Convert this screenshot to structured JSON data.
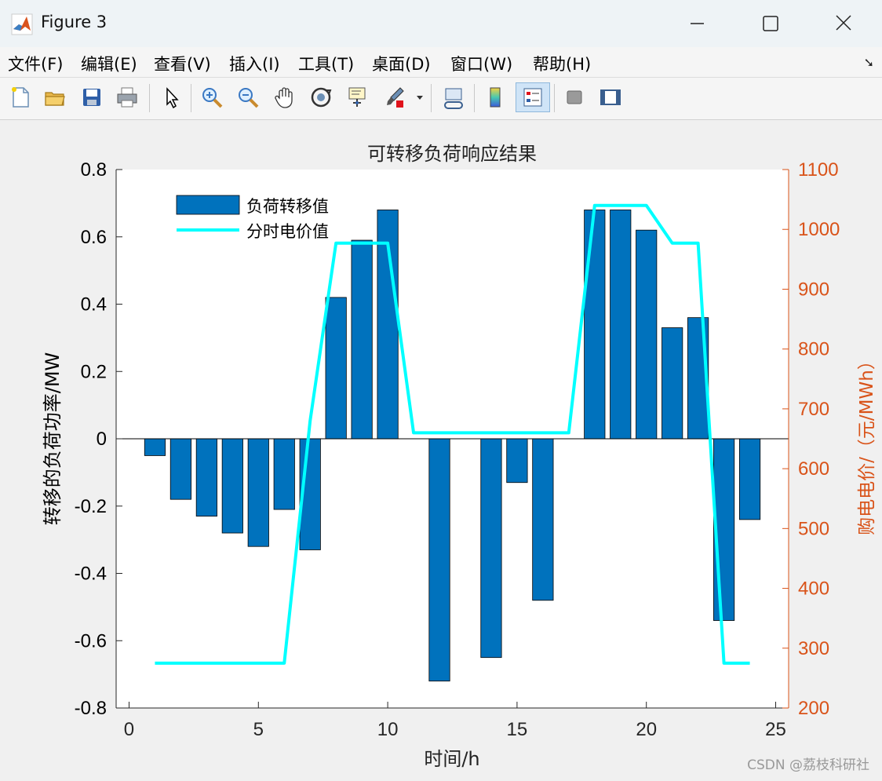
{
  "window": {
    "title": "Figure 3"
  },
  "menu": [
    {
      "label": "文件(F)"
    },
    {
      "label": "编辑(E)"
    },
    {
      "label": "查看(V)"
    },
    {
      "label": "插入(I)"
    },
    {
      "label": "工具(T)"
    },
    {
      "label": "桌面(D)"
    },
    {
      "label": "窗口(W)"
    },
    {
      "label": "帮助(H)"
    }
  ],
  "toolbar": [
    {
      "icon": "new-figure-icon"
    },
    {
      "icon": "open-file-icon"
    },
    {
      "icon": "save-icon"
    },
    {
      "icon": "print-icon"
    },
    {
      "icon": "select-arrow-icon"
    },
    {
      "icon": "zoom-in-icon"
    },
    {
      "icon": "zoom-out-icon"
    },
    {
      "icon": "pan-hand-icon"
    },
    {
      "icon": "rotate-3d-icon"
    },
    {
      "icon": "data-cursor-icon"
    },
    {
      "icon": "brush-icon"
    },
    {
      "icon": "link-plot-icon"
    },
    {
      "icon": "colorbar-icon"
    },
    {
      "icon": "legend-icon"
    },
    {
      "icon": "hide-plot-tools-icon"
    },
    {
      "icon": "show-plot-tools-icon"
    }
  ],
  "chart_data": {
    "type": "bar",
    "title": "可转移负荷响应结果",
    "xlabel": "时间/h",
    "ylabel_left": "转移的负荷功率/MW",
    "ylabel_right": "购电电价/（元/MWh）",
    "xlim": [
      -0.5,
      25.5
    ],
    "ylim_left": [
      -0.8,
      0.8
    ],
    "ylim_right": [
      200,
      1100
    ],
    "x_ticks": [
      "0",
      "5",
      "10",
      "15",
      "20",
      "25"
    ],
    "y_ticks_left": [
      "0.8",
      "0.6",
      "0.4",
      "0.2",
      "0",
      "-0.2",
      "-0.4",
      "-0.6",
      "-0.8"
    ],
    "y_ticks_right": [
      "1100",
      "1000",
      "900",
      "800",
      "700",
      "600",
      "500",
      "400",
      "300",
      "200"
    ],
    "x": [
      1,
      2,
      3,
      4,
      5,
      6,
      7,
      8,
      9,
      10,
      11,
      12,
      13,
      14,
      15,
      16,
      17,
      18,
      19,
      20,
      21,
      22,
      23,
      24
    ],
    "series": [
      {
        "name": "负荷转移值",
        "type": "bar",
        "axis": "left",
        "color": "#0072BD",
        "values": [
          -0.05,
          -0.18,
          -0.23,
          -0.28,
          -0.32,
          -0.21,
          -0.33,
          0.42,
          0.59,
          0.68,
          0,
          -0.72,
          0,
          -0.65,
          -0.13,
          -0.48,
          0,
          0.68,
          0.68,
          0.62,
          0.33,
          0.36,
          -0.54,
          -0.24
        ]
      },
      {
        "name": "分时电价值",
        "type": "line",
        "axis": "right",
        "color": "#00FFFF",
        "values": [
          275,
          275,
          275,
          275,
          275,
          275,
          680,
          977,
          977,
          977,
          660,
          660,
          660,
          660,
          660,
          660,
          660,
          1040,
          1040,
          1040,
          977,
          977,
          275,
          275
        ]
      }
    ],
    "right_axis_color": "#D95319",
    "legend_position": "top-left",
    "grid": false
  },
  "watermark": "CSDN @荔枝科研社"
}
